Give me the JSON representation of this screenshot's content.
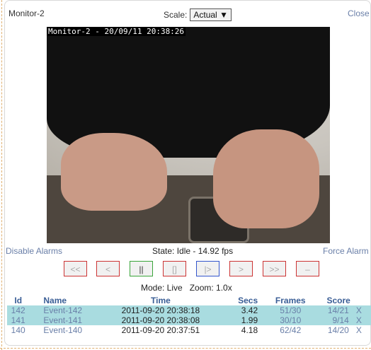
{
  "monitor": {
    "name": "Monitor-2",
    "close_label": "Close"
  },
  "scale": {
    "label": "Scale:",
    "value": "Actual"
  },
  "video": {
    "overlay_text": "Monitor-2 - 20/09/11 20:38:26"
  },
  "alarms": {
    "disable_label": "Disable Alarms",
    "state_text": "State: Idle - 14.92 fps",
    "force_label": "Force Alarm"
  },
  "controls": [
    {
      "label": "<<",
      "name": "fast-rewind-button"
    },
    {
      "label": "<",
      "name": "slow-rewind-button"
    },
    {
      "label": "||",
      "name": "pause-button"
    },
    {
      "label": "[]",
      "name": "stop-button"
    },
    {
      "label": "|>",
      "name": "play-button"
    },
    {
      "label": ">",
      "name": "slow-forward-button"
    },
    {
      "label": ">>",
      "name": "fast-forward-button"
    },
    {
      "label": "–",
      "name": "zoom-out-button"
    }
  ],
  "mode": {
    "text": "Mode: Live   Zoom: 1.0x"
  },
  "events_table": {
    "headers": {
      "id": "Id",
      "name": "Name",
      "time": "Time",
      "secs": "Secs",
      "frames": "Frames",
      "score": "Score"
    },
    "rows": [
      {
        "id": "142",
        "name": "Event-142",
        "time": "2011-09-20 20:38:18",
        "secs": "3.42",
        "frames": "51/30",
        "score": "14/21",
        "action": "X"
      },
      {
        "id": "141",
        "name": "Event-141",
        "time": "2011-09-20 20:38:08",
        "secs": "1.99",
        "frames": "30/10",
        "score": "9/14",
        "action": "X"
      },
      {
        "id": "140",
        "name": "Event-140",
        "time": "2011-09-20 20:37:51",
        "secs": "4.18",
        "frames": "62/42",
        "score": "14/20",
        "action": "X"
      }
    ]
  },
  "colors": {
    "link": "#6a7fa8",
    "header": "#3a5e96",
    "row_highlight": "#a9dce0",
    "red_border": "#cc3333",
    "green_border": "#3aa53a",
    "blue_border": "#3355cc"
  }
}
